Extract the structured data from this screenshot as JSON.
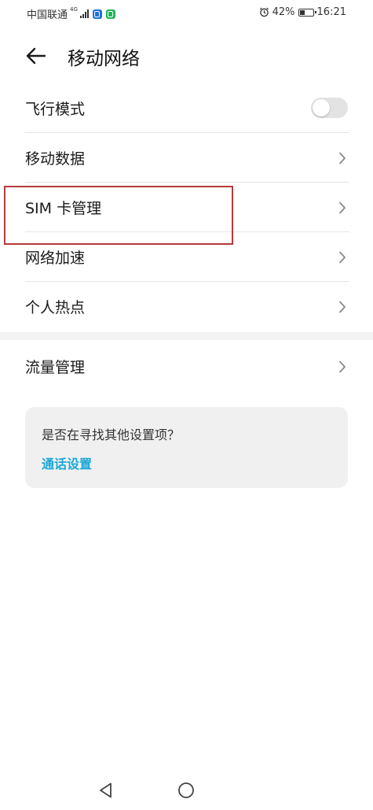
{
  "status_bar": {
    "carrier": "中国联通",
    "network_type": "4G",
    "battery_text": "42%",
    "battery_level": 0.42,
    "time": "16:21"
  },
  "header": {
    "title": "移动网络",
    "back_icon": "arrow-left-icon"
  },
  "settings": {
    "items": [
      {
        "label": "飞行模式",
        "control": "toggle",
        "toggle_on": false
      },
      {
        "label": "移动数据",
        "control": "chevron"
      },
      {
        "label": "SIM 卡管理",
        "control": "chevron",
        "highlighted": true
      },
      {
        "label": "网络加速",
        "control": "chevron"
      },
      {
        "label": "个人热点",
        "control": "chevron"
      }
    ],
    "section2": [
      {
        "label": "流量管理",
        "control": "chevron"
      }
    ]
  },
  "suggestion": {
    "question": "是否在寻找其他设置项？",
    "link": "通话设置"
  },
  "colors": {
    "accent_link": "#1aa7d6",
    "highlight_border": "#b73a3a",
    "toggle_off": "#e3e3e3"
  }
}
